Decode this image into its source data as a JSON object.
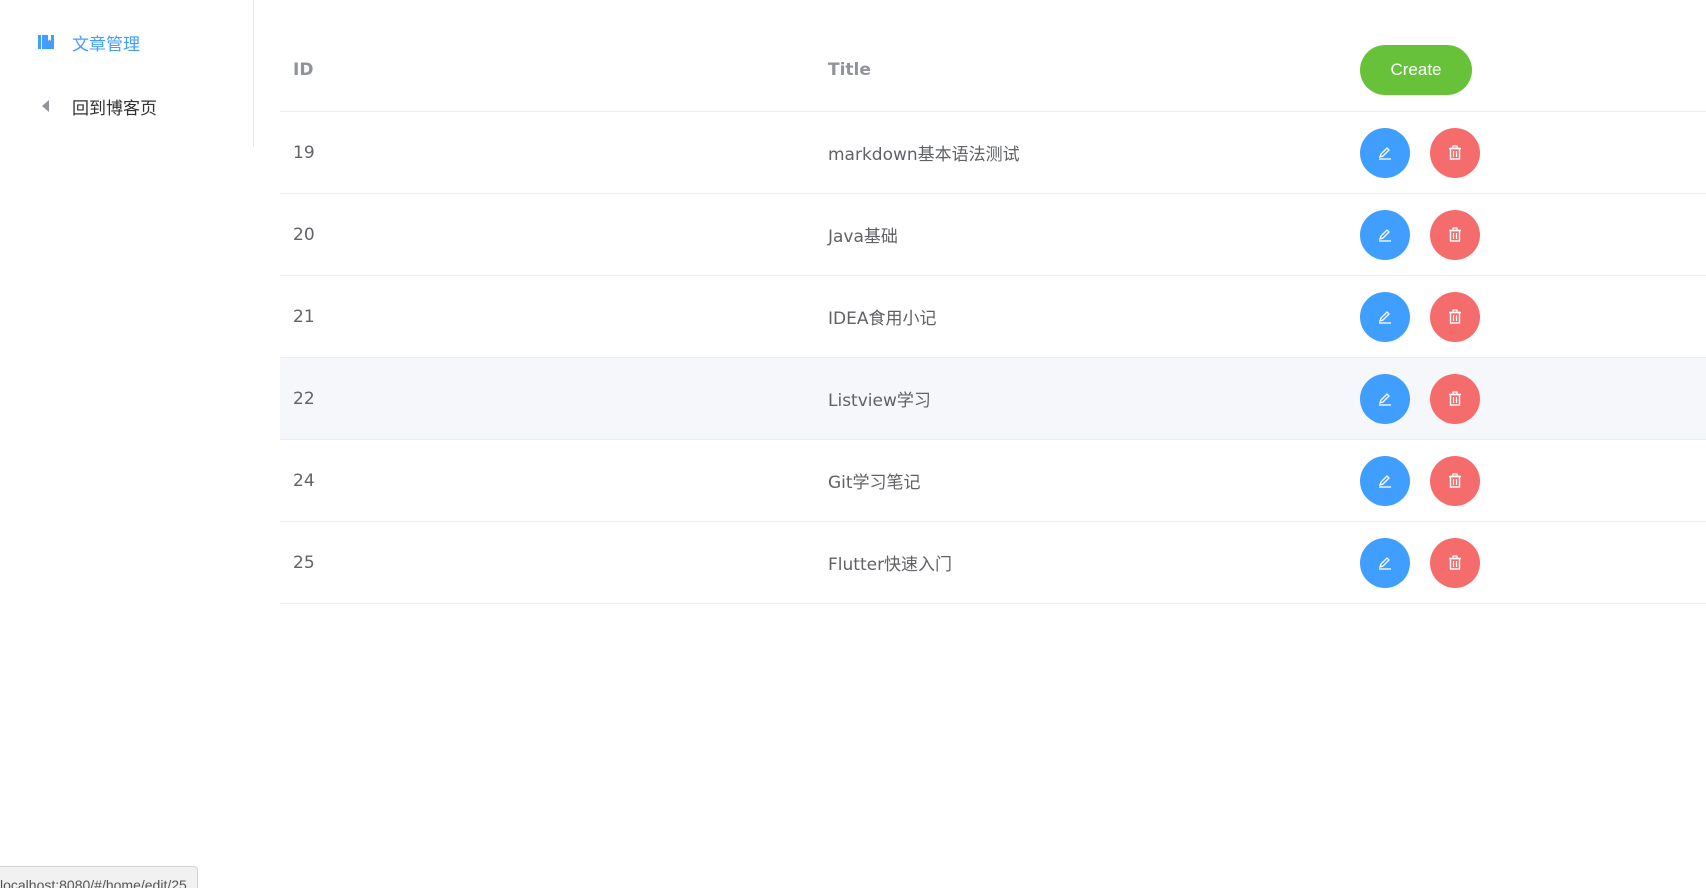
{
  "sidebar": {
    "items": [
      {
        "label": "文章管理",
        "icon": "notebook-icon",
        "active": true
      },
      {
        "label": "回到博客页",
        "icon": "caret-left-icon",
        "active": false
      }
    ]
  },
  "table": {
    "columns": {
      "id": "ID",
      "title": "Title"
    },
    "create_label": "Create",
    "rows": [
      {
        "id": "19",
        "title": "markdown基本语法测试"
      },
      {
        "id": "20",
        "title": "Java基础"
      },
      {
        "id": "21",
        "title": "IDEA食用小记"
      },
      {
        "id": "22",
        "title": "Listview学习"
      },
      {
        "id": "24",
        "title": "Git学习笔记"
      },
      {
        "id": "25",
        "title": "Flutter快速入门"
      }
    ],
    "hover_row_index": 3
  },
  "status_bar": {
    "url": "localhost:8080/#/home/edit/25"
  },
  "colors": {
    "primary": "#409eff",
    "success": "#67c23a",
    "danger": "#f56c6c",
    "hover_row": "#f5f7fa"
  }
}
